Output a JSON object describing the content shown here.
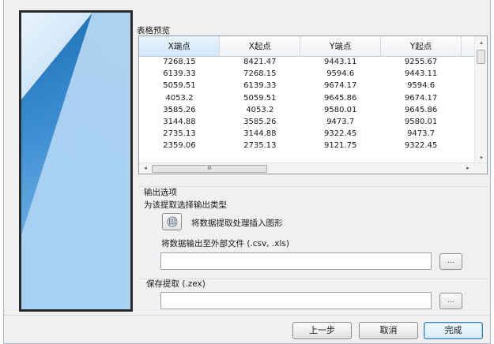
{
  "table_preview": {
    "label": "表格预览",
    "columns": [
      "X端点",
      "X起点",
      "Y端点",
      "Y起点"
    ],
    "rows": [
      [
        "7268.15",
        "8421.47",
        "9443.11",
        "9255.67"
      ],
      [
        "6139.33",
        "7268.15",
        "9594.6",
        "9443.11"
      ],
      [
        "5059.51",
        "6139.33",
        "9674.17",
        "9594.6"
      ],
      [
        "4053.2",
        "5059.51",
        "9645.86",
        "9674.17"
      ],
      [
        "3585.26",
        "4053.2",
        "9580.01",
        "9645.86"
      ],
      [
        "3144.88",
        "3585.26",
        "9473.7",
        "9580.01"
      ],
      [
        "2735.13",
        "3144.88",
        "9322.45",
        "9473.7"
      ],
      [
        "2359.06",
        "2735.13",
        "9121.75",
        "9322.45"
      ]
    ],
    "scroll_left": "◂",
    "scroll_right": "▸",
    "scroll_up": "▴",
    "scroll_down": "▾",
    "hscroll_grip": "III"
  },
  "output_options": {
    "label": "输出选项",
    "prompt": "为该提取选择输出类型",
    "insert_table_label": "将数据提取处理插入图形",
    "export_label": "将数据输出至外部文件 (.csv, .xls)",
    "export_path": "",
    "browse_label": "..."
  },
  "save_extract": {
    "label": "保存提取 (.zex)",
    "path": "",
    "browse_label": "..."
  },
  "buttons": {
    "back": "上一步",
    "cancel": "取消",
    "finish": "完成"
  }
}
